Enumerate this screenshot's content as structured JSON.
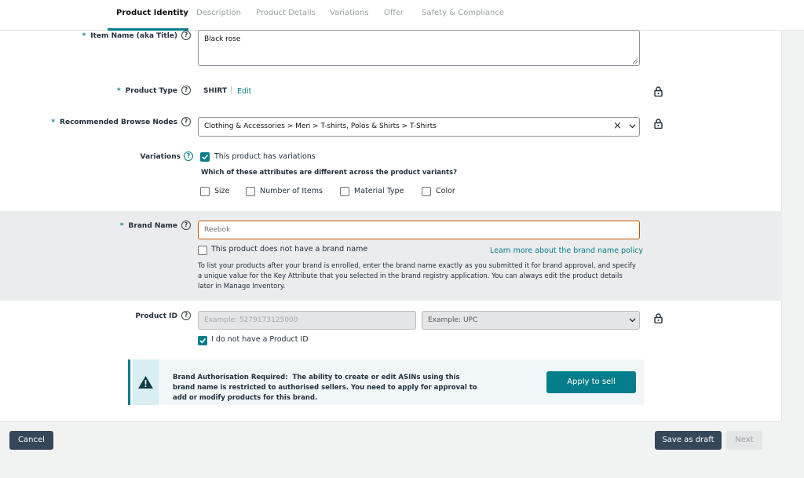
{
  "tabs": [
    "Product Identity",
    "Description",
    "Product Details",
    "Variations",
    "Offer",
    "Safety & Compliance"
  ],
  "item_name": {
    "label": "Item Name (aka Title)",
    "value": "Black rose"
  },
  "product_type": {
    "label": "Product Type",
    "value": "SHIRT",
    "edit": "Edit"
  },
  "browse_nodes": {
    "label": "Recommended Browse Nodes",
    "value": "Clothing & Accessories > Men > T-shirts, Polos & Shirts > T-Shirts"
  },
  "variations": {
    "label": "Variations",
    "checkbox_label": "This product has variations",
    "checked": true,
    "question": "Which of these attributes are different across the product variants?",
    "attributes": [
      "Size",
      "Number of Items",
      "Material Type",
      "Color"
    ]
  },
  "brand_name": {
    "label": "Brand Name",
    "value": "Reebok",
    "no_brand_label": "This product does not have a brand name",
    "policy_link": "Learn more about the brand name policy",
    "help_text": "To list your products after your brand is enrolled, enter the brand name exactly as you submitted it for brand approval, and specify a unique value for the Key Attribute that you selected in the brand registry application. You can always edit the product details later in Manage Inventory."
  },
  "product_id": {
    "label": "Product ID",
    "placeholder": "Example: 5279173125000",
    "type_placeholder": "Example: UPC",
    "no_id_label": "I do not have a Product ID",
    "checked": true
  },
  "alert": {
    "title": "Brand Authorisation Required:",
    "message": "The ability to create or edit ASINs using this brand name is restricted to authorised sellers. You need to apply for approval to add or modify products for this brand.",
    "button": "Apply to sell"
  },
  "footer": {
    "cancel": "Cancel",
    "save_draft": "Save as draft",
    "next": "Next"
  },
  "colors": {
    "accent": "#067d8a",
    "dark_button": "#232f3e",
    "focus_border": "#c45500"
  }
}
